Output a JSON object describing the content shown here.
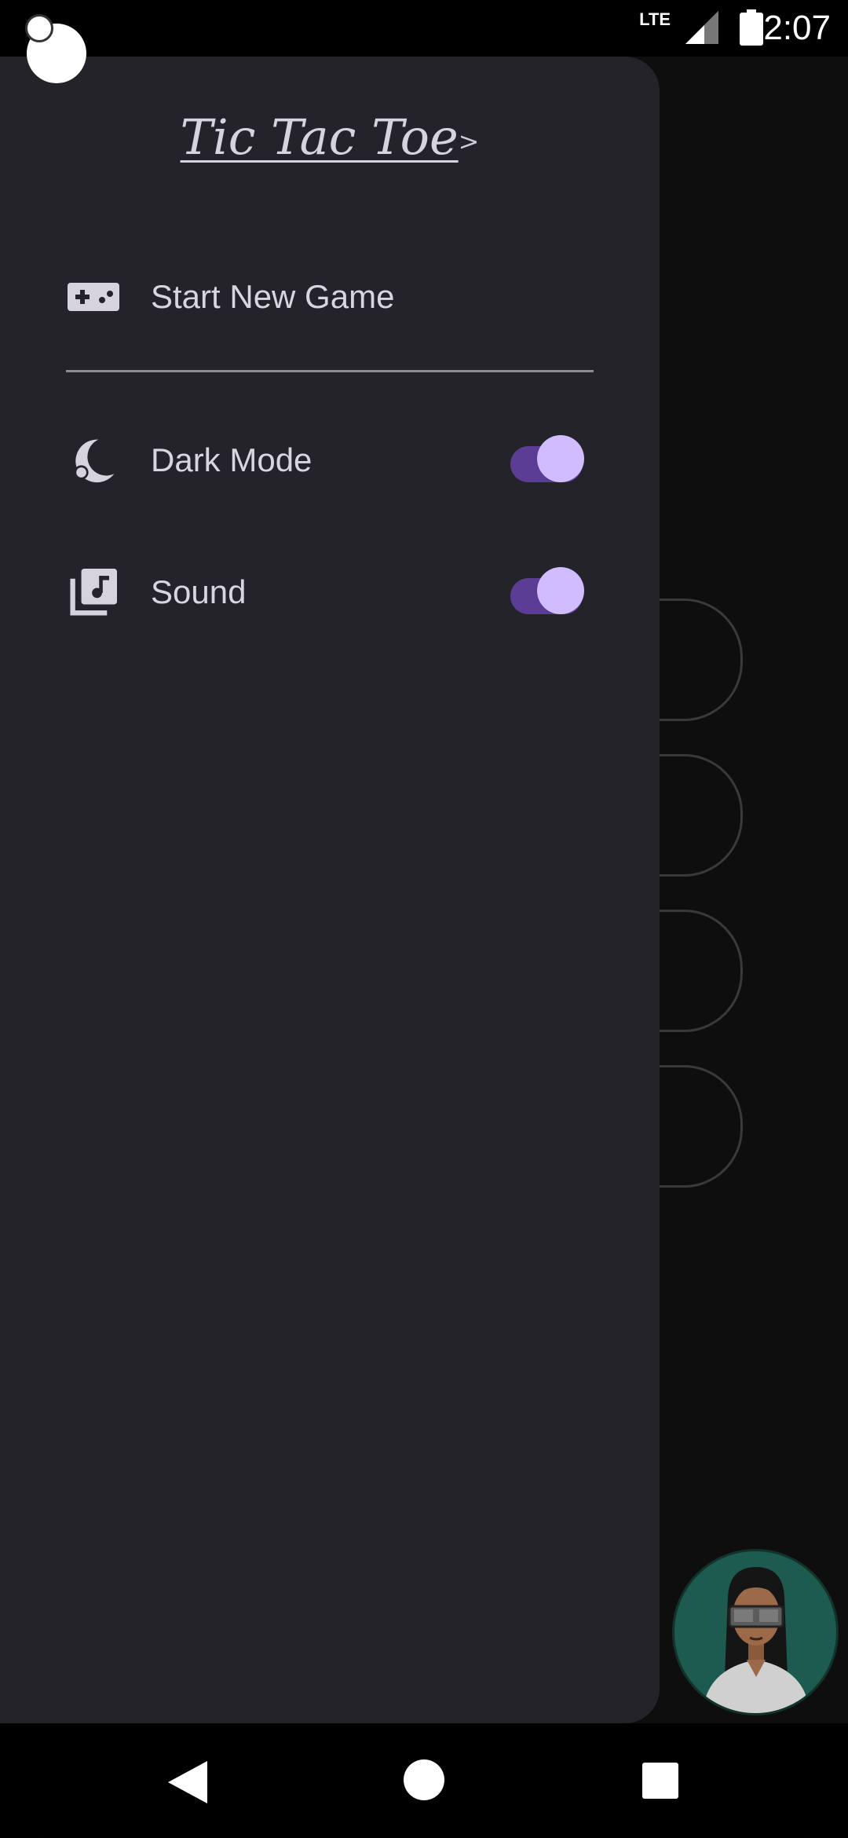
{
  "status_bar": {
    "network": "LTE",
    "time": "12:07"
  },
  "drawer": {
    "title": "Tic Tac Toe",
    "title_suffix": ">",
    "items": [
      {
        "label": "Start New Game",
        "icon": "gamepad-icon"
      },
      {
        "label": "Dark Mode",
        "icon": "dark-mode-icon",
        "toggle": true,
        "on": true
      },
      {
        "label": "Sound",
        "icon": "music-library-icon",
        "toggle": true,
        "on": true
      }
    ]
  },
  "colors": {
    "drawer_bg": "#242329",
    "switch_track": "#5b3d96",
    "switch_thumb": "#d1bcff",
    "text": "#d9d5df"
  },
  "nav": {
    "back": "back-icon",
    "home": "home-icon",
    "recents": "recents-icon"
  }
}
